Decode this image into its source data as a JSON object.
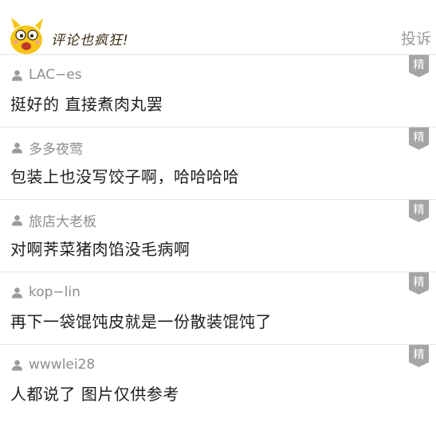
{
  "header": {
    "title": "评论也疯狂!",
    "report_label": "投诉"
  },
  "badge_label": "精",
  "comments": [
    {
      "user": "LAC−es",
      "text": "挺好的 直接煮肉丸罢"
    },
    {
      "user": "多多夜莺",
      "text": "包装上也没写饺子啊，哈哈哈哈"
    },
    {
      "user": "旅店大老板",
      "text": "对啊荠菜猪肉馅没毛病啊"
    },
    {
      "user": "kop−lin",
      "text": "再下一袋馄饨皮就是一份散装馄饨了"
    },
    {
      "user": "wwwlei28",
      "text": "人都说了 图片仅供参考"
    }
  ],
  "colors": {
    "username": "#8e8e8e",
    "text": "#1e1e1e",
    "badge": "#a5a5a5",
    "divider": "#e6e6e6",
    "mascot": "#f5c518"
  }
}
